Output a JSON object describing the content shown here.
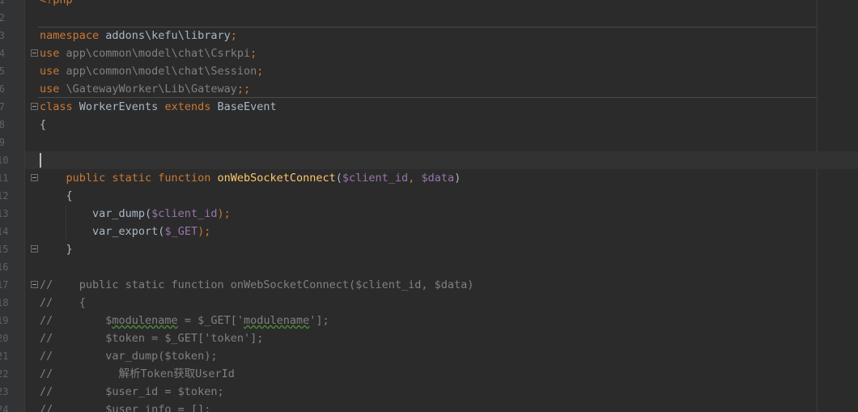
{
  "editor": {
    "lines": [
      {
        "num": "1",
        "parts": [
          {
            "t": "<?php",
            "c": "php"
          }
        ]
      },
      {
        "num": "2",
        "parts": []
      },
      {
        "num": "3",
        "parts": [
          {
            "t": "namespace",
            "c": "kw"
          },
          {
            "t": " addons\\kefu\\library",
            "c": "plain"
          },
          {
            "t": ";",
            "c": "kw"
          }
        ]
      },
      {
        "num": "4",
        "parts": [
          {
            "t": "use",
            "c": "kw"
          },
          {
            "t": " app\\common\\model\\chat\\Csrkpi",
            "c": "dim"
          },
          {
            "t": ";",
            "c": "kw"
          }
        ]
      },
      {
        "num": "5",
        "parts": [
          {
            "t": "use",
            "c": "kw"
          },
          {
            "t": " app\\common\\model\\chat\\Session",
            "c": "dim"
          },
          {
            "t": ";",
            "c": "kw"
          }
        ]
      },
      {
        "num": "6",
        "parts": [
          {
            "t": "use",
            "c": "kw"
          },
          {
            "t": " \\GatewayWorker\\Lib\\Gateway",
            "c": "dim"
          },
          {
            "t": ";;",
            "c": "kw"
          }
        ]
      },
      {
        "num": "7",
        "parts": [
          {
            "t": "class",
            "c": "kw"
          },
          {
            "t": " WorkerEvents ",
            "c": "plain"
          },
          {
            "t": "extends",
            "c": "kw"
          },
          {
            "t": " BaseEvent",
            "c": "plain"
          }
        ]
      },
      {
        "num": "8",
        "parts": [
          {
            "t": "{",
            "c": "plain"
          }
        ]
      },
      {
        "num": "9",
        "parts": []
      },
      {
        "num": "10",
        "parts": []
      },
      {
        "num": "11",
        "parts": [
          {
            "t": "    ",
            "c": "plain"
          },
          {
            "t": "public static function ",
            "c": "kw"
          },
          {
            "t": "onWebSocketConnect",
            "c": "fn"
          },
          {
            "t": "(",
            "c": "plain"
          },
          {
            "t": "$client_id",
            "c": "var"
          },
          {
            "t": ", ",
            "c": "kw"
          },
          {
            "t": "$data",
            "c": "var"
          },
          {
            "t": ")",
            "c": "plain"
          }
        ]
      },
      {
        "num": "12",
        "parts": [
          {
            "t": "    {",
            "c": "plain"
          }
        ]
      },
      {
        "num": "13",
        "parts": [
          {
            "t": "        var_dump(",
            "c": "plain"
          },
          {
            "t": "$client_id",
            "c": "var"
          },
          {
            "t": ");",
            "c": "kw"
          }
        ]
      },
      {
        "num": "14",
        "parts": [
          {
            "t": "        var_export(",
            "c": "plain"
          },
          {
            "t": "$_GET",
            "c": "var"
          },
          {
            "t": ");",
            "c": "kw"
          }
        ]
      },
      {
        "num": "15",
        "parts": [
          {
            "t": "    }",
            "c": "plain"
          }
        ]
      },
      {
        "num": "16",
        "parts": []
      },
      {
        "num": "17",
        "parts": [
          {
            "t": "//    public static function onWebSocketConnect($client_id, $data)",
            "c": "cmt"
          }
        ]
      },
      {
        "num": "18",
        "parts": [
          {
            "t": "//    {",
            "c": "cmt"
          }
        ]
      },
      {
        "num": "19",
        "parts": [
          {
            "t": "//        $",
            "c": "cmt"
          },
          {
            "t": "modulename",
            "c": "cmt squig"
          },
          {
            "t": " = $_GET['",
            "c": "cmt"
          },
          {
            "t": "modulename",
            "c": "cmt squig"
          },
          {
            "t": "'];",
            "c": "cmt"
          }
        ]
      },
      {
        "num": "20",
        "parts": [
          {
            "t": "//        $token = $_GET['token'];",
            "c": "cmt"
          }
        ]
      },
      {
        "num": "21",
        "parts": [
          {
            "t": "//        var_dump($token);",
            "c": "cmt"
          }
        ]
      },
      {
        "num": "22",
        "parts": [
          {
            "t": "//          解析Token获取UserId",
            "c": "cmt"
          }
        ]
      },
      {
        "num": "23",
        "parts": [
          {
            "t": "//        $user_id = $token;",
            "c": "cmt"
          }
        ]
      },
      {
        "num": "24",
        "parts": [
          {
            "t": "//        $user_info = [];",
            "c": "cmt"
          }
        ]
      }
    ]
  }
}
